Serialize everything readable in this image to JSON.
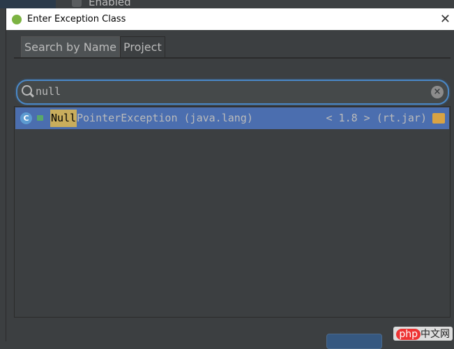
{
  "background": {
    "checkbox_label": "Enabled"
  },
  "dialog": {
    "title": "Enter Exception Class",
    "close": "✕"
  },
  "tabs": [
    {
      "label": "Search by Name"
    },
    {
      "label": "Project"
    }
  ],
  "search": {
    "value": "null"
  },
  "results": [
    {
      "match": "Null",
      "rest": "PointerException (java.lang)",
      "version": "< 1.8 > (rt.jar)"
    }
  ],
  "watermark": {
    "brand": "php",
    "text": "中文网"
  },
  "colors": {
    "selection": "#4b6eaf",
    "focus": "#4a88c7",
    "highlight": "#c9ad5c"
  }
}
